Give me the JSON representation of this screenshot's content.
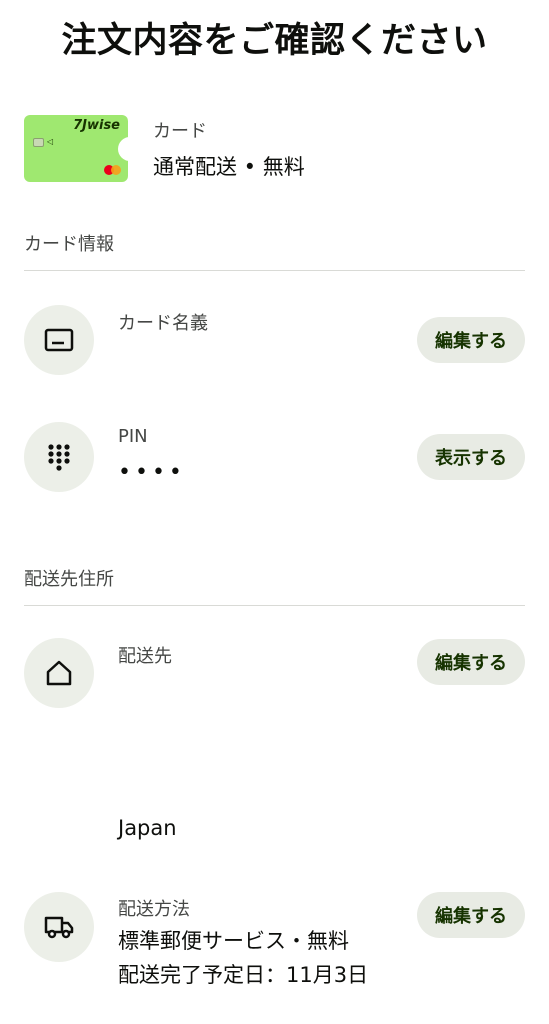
{
  "page": {
    "title": "注文内容をご確認ください"
  },
  "card_summary": {
    "logo": "7Jwise",
    "kind_label": "カード",
    "shipping_text": "通常配送 • 無料"
  },
  "card_info": {
    "section_title": "カード情報",
    "name_row": {
      "label": "カード名義",
      "action": "編集する",
      "icon": "id-card-icon"
    },
    "pin_row": {
      "label": "PIN",
      "value": "••••",
      "action": "表示する",
      "icon": "keypad-icon"
    }
  },
  "shipping": {
    "section_title": "配送先住所",
    "address_row": {
      "label": "配送先",
      "action": "編集する",
      "icon": "home-icon",
      "country": "Japan"
    },
    "method_row": {
      "label": "配送方法",
      "value_line1": "標準郵便サービス・無料",
      "value_line2": "配送完了予定日：11月3日",
      "action": "編集する",
      "icon": "truck-icon"
    }
  },
  "colors": {
    "accent_green": "#9fe870",
    "button_bg": "#e8ebe4",
    "button_text": "#163300"
  }
}
